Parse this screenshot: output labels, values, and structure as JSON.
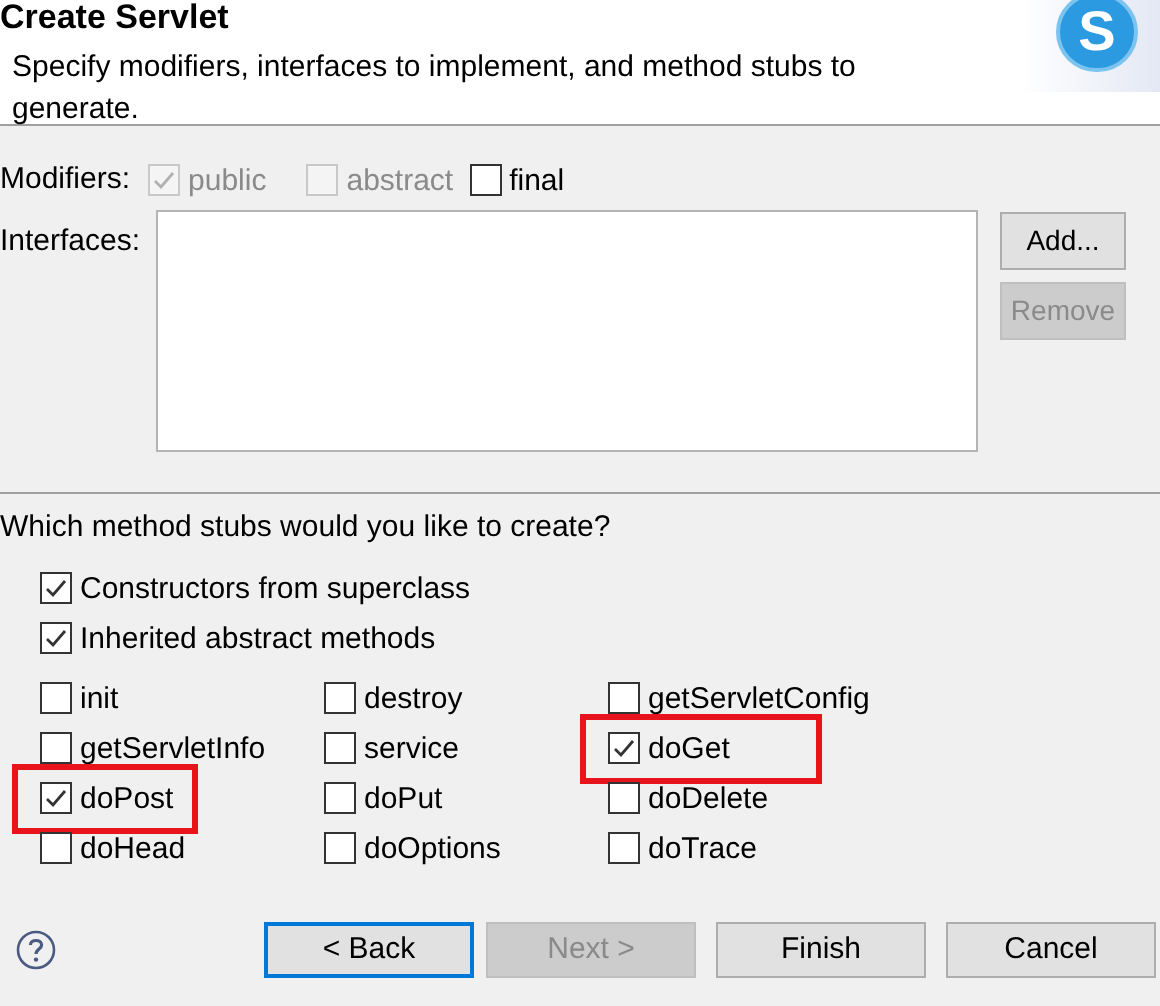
{
  "header": {
    "title": "Create Servlet",
    "description": "Specify modifiers, interfaces to implement, and method stubs to generate.",
    "logo_letter": "S"
  },
  "modifiers": {
    "label": "Modifiers:",
    "options": [
      {
        "label": "public",
        "checked": true,
        "disabled": true
      },
      {
        "label": "abstract",
        "checked": false,
        "disabled": true
      },
      {
        "label": "final",
        "checked": false,
        "disabled": false
      }
    ]
  },
  "interfaces": {
    "label": "Interfaces:",
    "buttons": [
      {
        "label": "Add...",
        "disabled": false
      },
      {
        "label": "Remove",
        "disabled": true
      }
    ]
  },
  "stubs": {
    "question": "Which method stubs would you like to create?",
    "general": [
      {
        "label": "Constructors from superclass",
        "checked": true
      },
      {
        "label": "Inherited abstract methods",
        "checked": true
      }
    ],
    "methods": [
      {
        "label": "init",
        "checked": false,
        "highlighted": false
      },
      {
        "label": "destroy",
        "checked": false,
        "highlighted": false
      },
      {
        "label": "getServletConfig",
        "checked": false,
        "highlighted": false
      },
      {
        "label": "getServletInfo",
        "checked": false,
        "highlighted": false
      },
      {
        "label": "service",
        "checked": false,
        "highlighted": false
      },
      {
        "label": "doGet",
        "checked": true,
        "highlighted": true
      },
      {
        "label": "doPost",
        "checked": true,
        "highlighted": true
      },
      {
        "label": "doPut",
        "checked": false,
        "highlighted": false
      },
      {
        "label": "doDelete",
        "checked": false,
        "highlighted": false
      },
      {
        "label": "doHead",
        "checked": false,
        "highlighted": false
      },
      {
        "label": "doOptions",
        "checked": false,
        "highlighted": false
      },
      {
        "label": "doTrace",
        "checked": false,
        "highlighted": false
      }
    ]
  },
  "footer": {
    "buttons": [
      {
        "label": "< Back",
        "disabled": false,
        "focused": true
      },
      {
        "label": "Next >",
        "disabled": true,
        "focused": false
      },
      {
        "label": "Finish",
        "disabled": false,
        "focused": false
      },
      {
        "label": "Cancel",
        "disabled": false,
        "focused": false
      }
    ]
  }
}
